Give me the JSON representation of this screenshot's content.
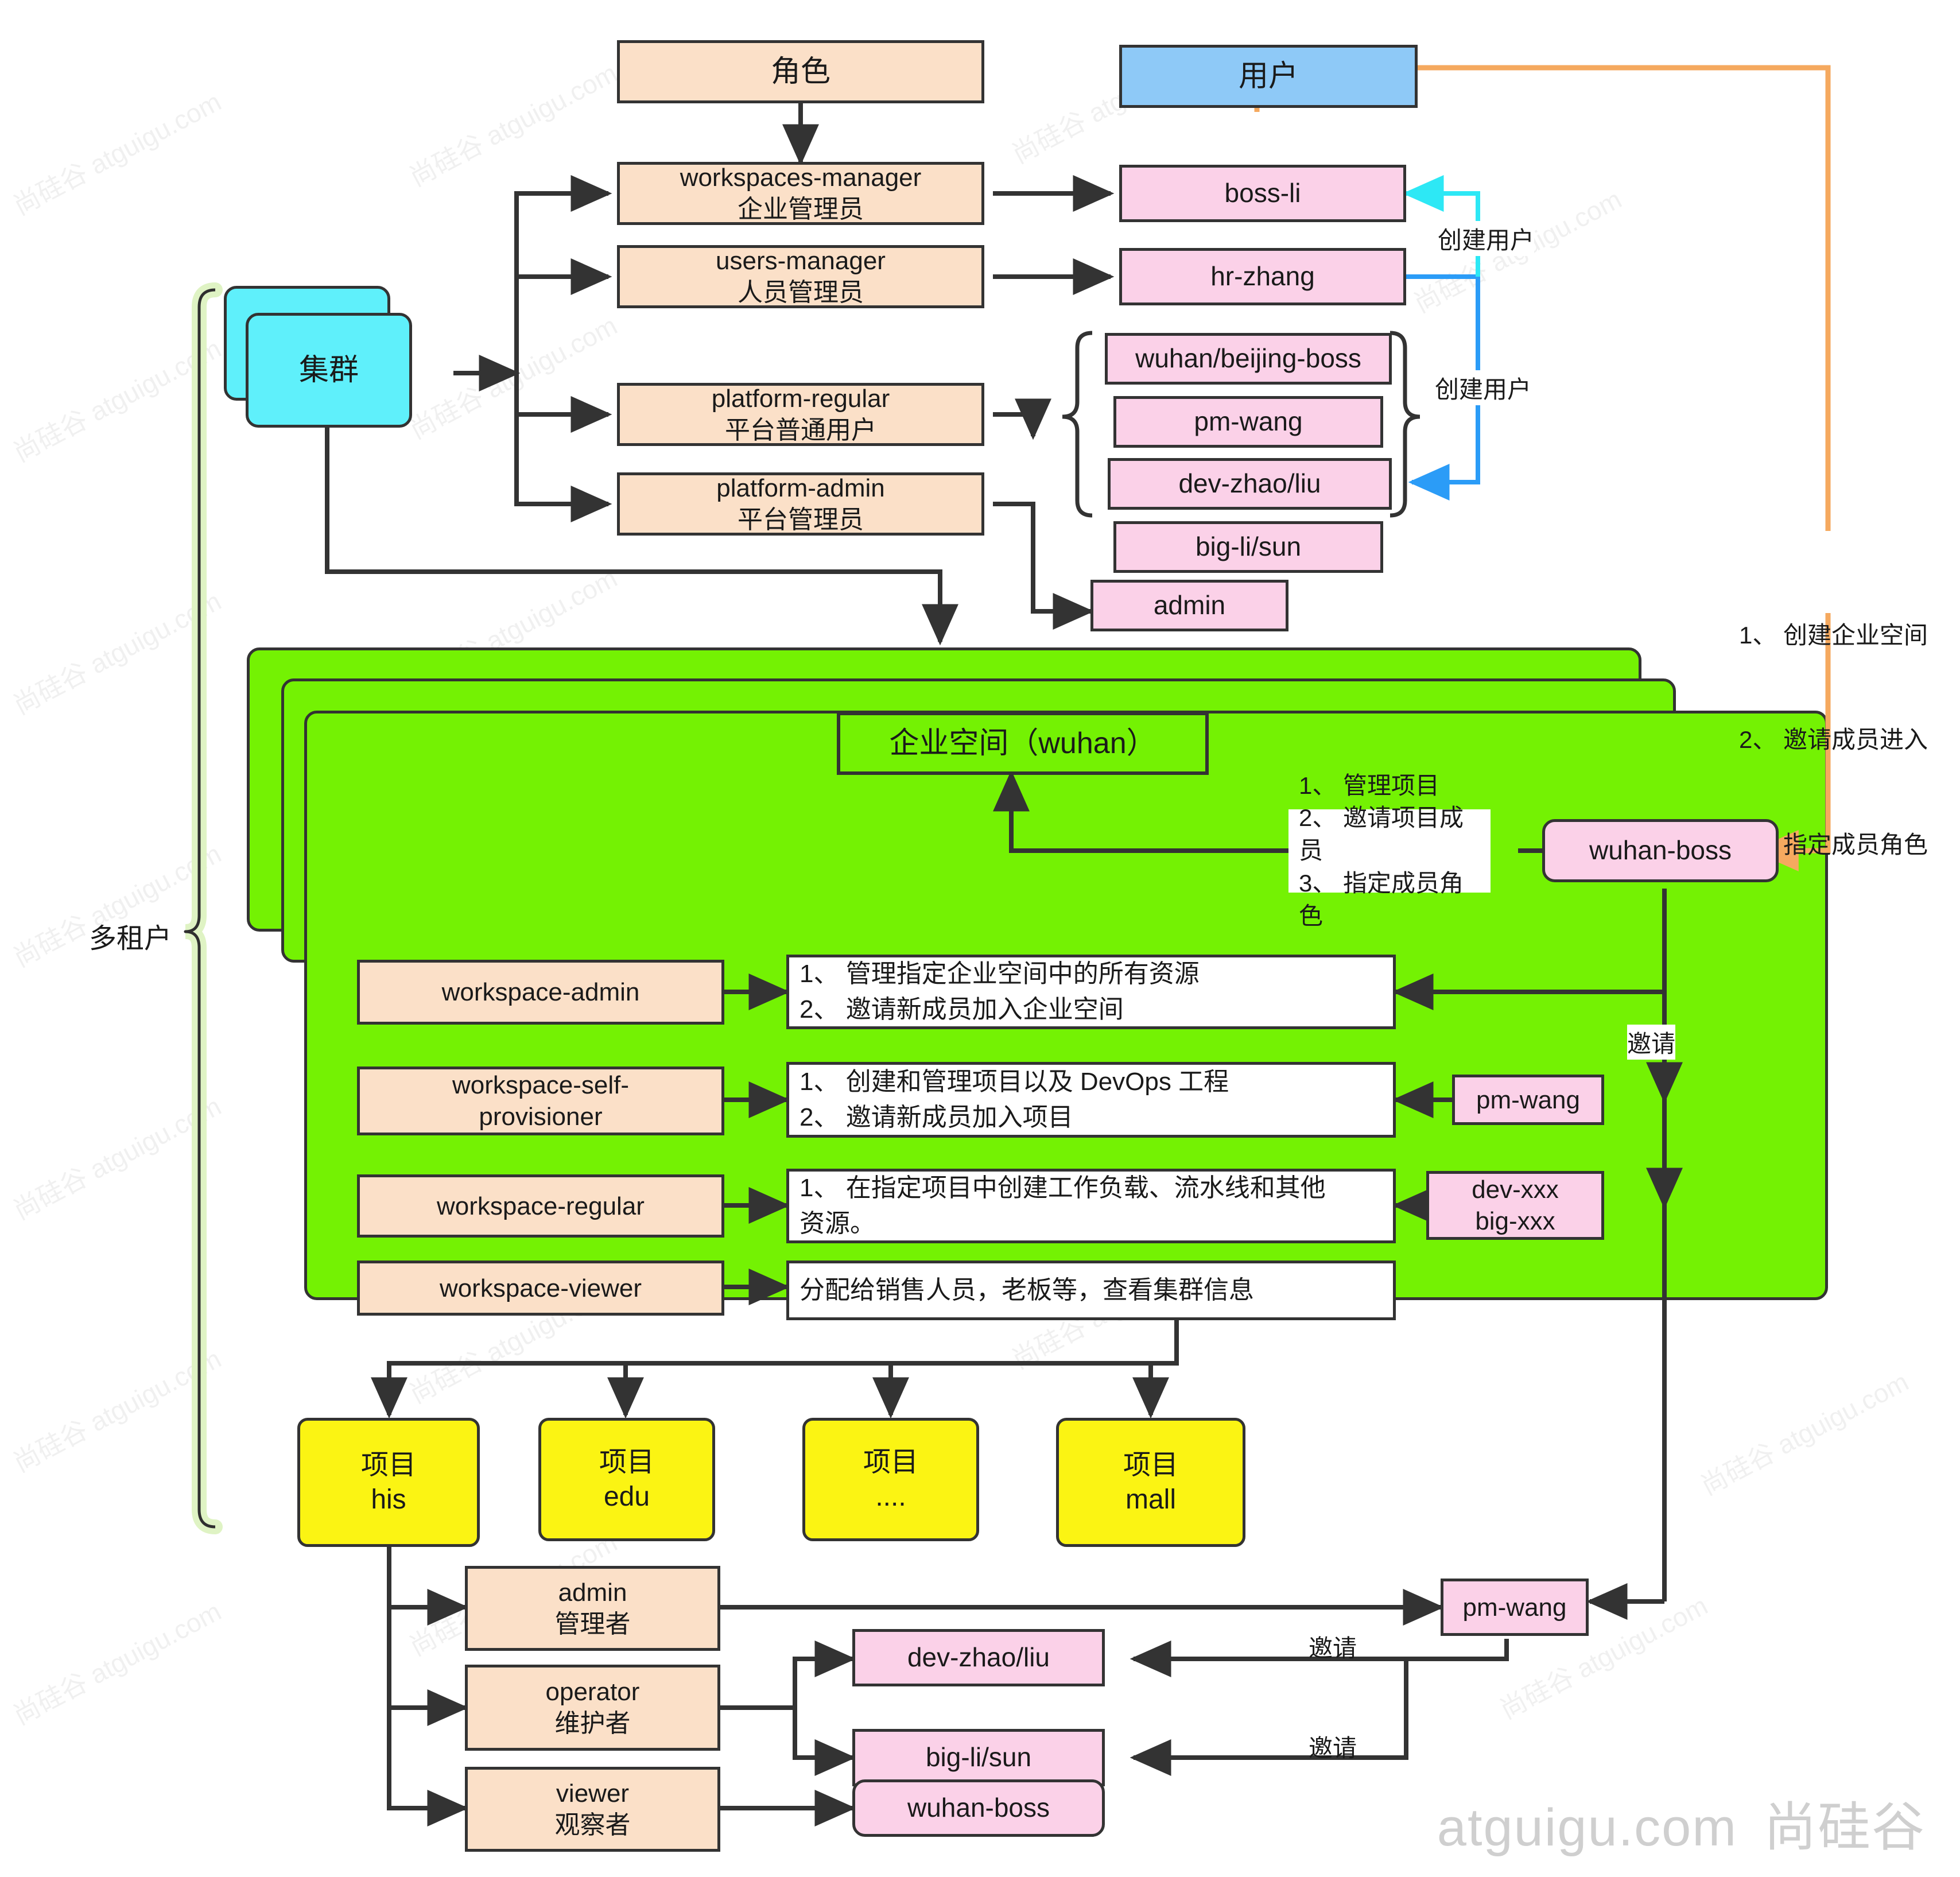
{
  "headers": {
    "role": "角色",
    "user": "用户"
  },
  "cluster": {
    "label": "集群"
  },
  "multitenant": {
    "label": "多租户"
  },
  "platform_roles": [
    {
      "en": "workspaces-manager",
      "cn": "企业管理员"
    },
    {
      "en": "users-manager",
      "cn": "人员管理员"
    },
    {
      "en": "platform-regular",
      "cn": "平台普通用户"
    },
    {
      "en": "platform-admin",
      "cn": "平台管理员"
    }
  ],
  "platform_users": [
    {
      "name": "boss-li"
    },
    {
      "name": "hr-zhang"
    },
    {
      "name": "wuhan/beijing-boss"
    },
    {
      "name": "pm-wang"
    },
    {
      "name": "dev-zhao/liu"
    },
    {
      "name": "big-li/sun"
    },
    {
      "name": "admin"
    }
  ],
  "edge_labels": {
    "create_user_1": "创建用户",
    "create_user_2": "创建用户",
    "invite_ws": "邀请",
    "invite_dev": "邀请",
    "invite_big": "邀请"
  },
  "boss_li_note": {
    "lines": [
      "1、 创建企业空间",
      "2、 邀请成员进入",
      "3、 指定成员角色"
    ]
  },
  "workspace": {
    "title": "企业空间（wuhan）",
    "boss": "wuhan-boss",
    "boss_note": {
      "lines": [
        "1、 管理项目",
        "2、 邀请项目成员",
        "3、 指定成员角色"
      ]
    },
    "roles": [
      {
        "name": "workspace-admin",
        "desc": "1、 管理指定企业空间中的所有资源\n2、 邀请新成员加入企业空间",
        "member": ""
      },
      {
        "name": "workspace-self-\nprovisioner",
        "desc": "1、 创建和管理项目以及 DevOps 工程\n2、 邀请新成员加入项目",
        "member": "pm-wang"
      },
      {
        "name": "workspace-regular",
        "desc": "1、 在指定项目中创建工作负载、流水线和其他\n资源。",
        "member": "dev-xxx\nbig-xxx"
      },
      {
        "name": "workspace-viewer",
        "desc": "分配给销售人员，老板等，查看集群信息",
        "member": ""
      }
    ]
  },
  "projects": [
    {
      "label": "项目\nhis"
    },
    {
      "label": "项目\nedu"
    },
    {
      "label": "项目\n...."
    },
    {
      "label": "项目\nmall"
    }
  ],
  "project_roles": [
    {
      "en": "admin",
      "cn": "管理者"
    },
    {
      "en": "operator",
      "cn": "维护者"
    },
    {
      "en": "viewer",
      "cn": "观察者"
    }
  ],
  "project_members": [
    {
      "name": "dev-zhao/liu"
    },
    {
      "name": "big-li/sun"
    },
    {
      "name": "wuhan-boss"
    },
    {
      "name": "pm-wang"
    }
  ],
  "brand": {
    "site": "atguigu.com",
    "cn": "尚硅谷"
  },
  "watermark": {
    "text": "尚硅谷 atguigu.com"
  },
  "colors": {
    "role_fill": "#fbe0c8",
    "user_fill": "#fbd1e8",
    "user_header_fill": "#8ec9f7",
    "cluster_fill": "#5ff0fb",
    "workspace_fill": "#74f203",
    "project_fill": "#fbf413",
    "stroke": "#333333",
    "orange_edge": "#f5a95f",
    "blue_edge": "#2b9cf7",
    "cyan_edge": "#2de8f5",
    "tenant_bracket": "#dff3c4"
  }
}
